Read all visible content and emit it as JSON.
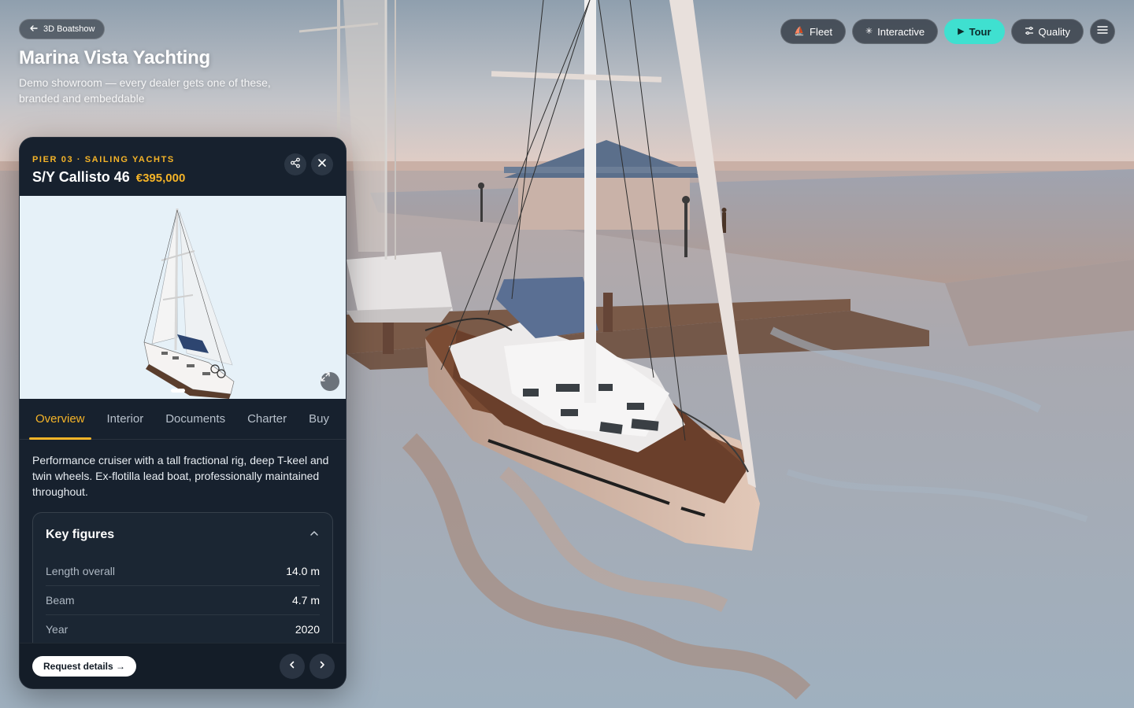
{
  "header": {
    "back_label": "3D Boatshow",
    "title": "Marina Vista Yachting",
    "subtitle": "Demo showroom — every dealer gets one of these, branded and embeddable"
  },
  "toolbar": {
    "fleet_label": "Fleet",
    "interactive_label": "Interactive",
    "tour_label": "Tour",
    "quality_label": "Quality",
    "fleet_icon": "sailboat-icon",
    "interactive_icon": "sparkle-icon",
    "tour_icon": "play-icon",
    "quality_icon": "sliders-icon",
    "menu_icon": "hamburger-icon",
    "active_item": "Tour"
  },
  "listing": {
    "eyebrow": "PIER 03 · SAILING YACHTS",
    "name": "S/Y Callisto 46",
    "price": "€395,000",
    "tabs": [
      "Overview",
      "Interior",
      "Documents",
      "Charter",
      "Buy"
    ],
    "active_tab": "Overview",
    "description": "Performance cruiser with a tall fractional rig, deep T-keel and twin wheels. Ex-flotilla lead boat, professionally maintained throughout.",
    "key_figures": {
      "title": "Key figures",
      "rows": [
        {
          "label": "Length overall",
          "value": "14.0 m"
        },
        {
          "label": "Beam",
          "value": "4.7 m"
        },
        {
          "label": "Year",
          "value": "2020"
        }
      ]
    },
    "cta_label": "Request details →"
  },
  "colors": {
    "accent": "#f5b428",
    "tour_active": "#3fe0d0",
    "panel_bg": "#17212e"
  }
}
